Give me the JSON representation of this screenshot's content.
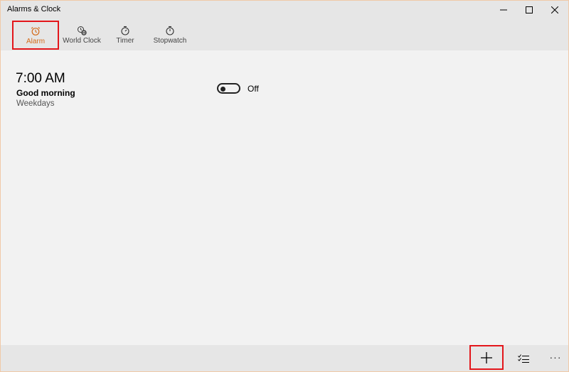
{
  "window": {
    "title": "Alarms & Clock"
  },
  "tabs": [
    {
      "label": "Alarm",
      "icon": "alarm-clock-icon",
      "active": true
    },
    {
      "label": "World Clock",
      "icon": "world-clock-icon",
      "active": false
    },
    {
      "label": "Timer",
      "icon": "timer-icon",
      "active": false
    },
    {
      "label": "Stopwatch",
      "icon": "stopwatch-icon",
      "active": false
    }
  ],
  "alarms": [
    {
      "time": "7:00 AM",
      "name": "Good morning",
      "repeat": "Weekdays",
      "toggle_state": "Off"
    }
  ],
  "commandbar": {
    "items": [
      "add-icon",
      "select-icon",
      "more-icon"
    ],
    "more_label": "···"
  },
  "colors": {
    "accent": "#d46b1a",
    "highlight": "#e3161b",
    "chrome": "#e6e6e6",
    "content": "#f2f2f2"
  }
}
